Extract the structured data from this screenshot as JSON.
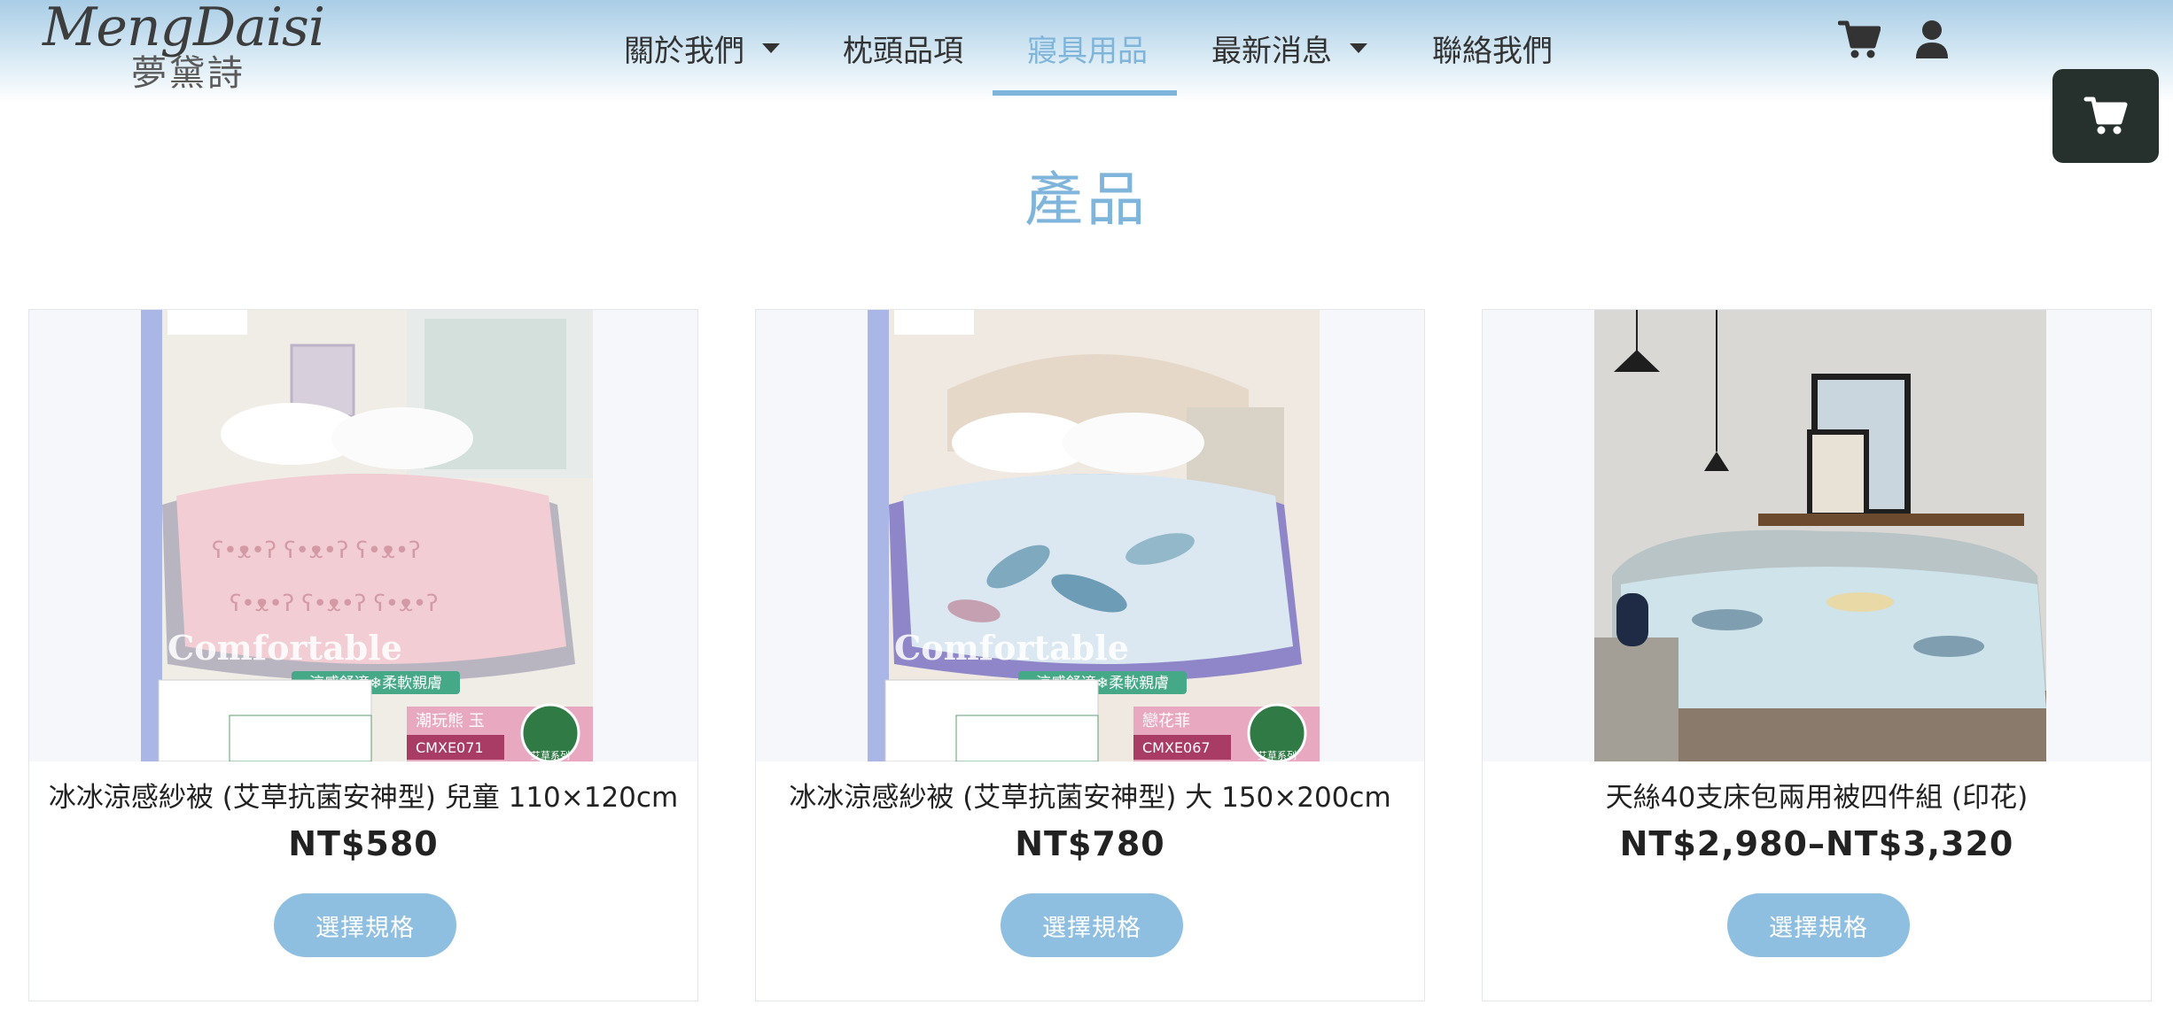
{
  "logo": {
    "script": "MengDaisi",
    "chinese": "夢黛詩"
  },
  "nav": {
    "items": [
      {
        "label": "關於我們",
        "dropdown": true
      },
      {
        "label": "枕頭品項",
        "dropdown": false
      },
      {
        "label": "寢具用品",
        "dropdown": false,
        "active": true
      },
      {
        "label": "最新消息",
        "dropdown": true
      },
      {
        "label": "聯絡我們",
        "dropdown": false
      }
    ],
    "icons": [
      "cart-icon",
      "user-icon"
    ]
  },
  "floating_cart": {
    "icon": "cart-icon"
  },
  "page": {
    "title": "產品"
  },
  "products": [
    {
      "name": "冰冰涼感紗被 (艾草抗菌安神型) 兒童 110×120cm",
      "price": "NT$580",
      "button": "選擇規格",
      "image": {
        "watermark": "Comfortable",
        "tagline": "涼感舒適❄柔軟親膚",
        "pattern_name": "潮玩熊 玉",
        "code": "CMXE071",
        "badge": "艾草系列",
        "quilt_color": "#f2cdd3"
      }
    },
    {
      "name": "冰冰涼感紗被 (艾草抗菌安神型) 大 150×200cm",
      "price": "NT$780",
      "button": "選擇規格",
      "image": {
        "watermark": "Comfortable",
        "tagline": "涼感舒適❄柔軟親膚",
        "pattern_name": "戀花菲",
        "code": "CMXE067",
        "badge": "艾草系列",
        "quilt_color": "#dbe8f1"
      }
    },
    {
      "name": "天絲40支床包兩用被四件組 (印花)",
      "price": "NT$2,980–NT$3,320",
      "button": "選擇規格",
      "image": {
        "quilt_color": "#cfe3ea"
      }
    }
  ],
  "colors": {
    "accent": "#7fb5da",
    "button": "#8fbfe0",
    "floating_cart_bg": "#26312d",
    "text": "#222222"
  }
}
